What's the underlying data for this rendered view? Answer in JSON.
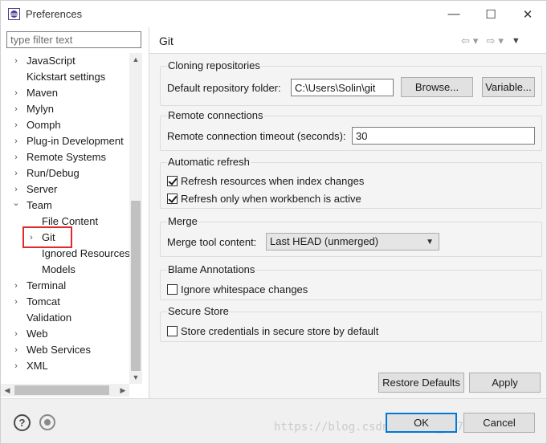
{
  "window": {
    "title": "Preferences",
    "minimize_glyph": "—",
    "maximize_glyph": "☐",
    "close_glyph": "✕"
  },
  "left": {
    "filter_placeholder": "type filter text",
    "tree": [
      {
        "label": "JavaScript",
        "level": 0,
        "expandable": true,
        "expanded": false
      },
      {
        "label": "Kickstart settings",
        "level": 0,
        "expandable": false
      },
      {
        "label": "Maven",
        "level": 0,
        "expandable": true,
        "expanded": false
      },
      {
        "label": "Mylyn",
        "level": 0,
        "expandable": true,
        "expanded": false
      },
      {
        "label": "Oomph",
        "level": 0,
        "expandable": true,
        "expanded": false
      },
      {
        "label": "Plug-in Development",
        "level": 0,
        "expandable": true,
        "expanded": false
      },
      {
        "label": "Remote Systems",
        "level": 0,
        "expandable": true,
        "expanded": false
      },
      {
        "label": "Run/Debug",
        "level": 0,
        "expandable": true,
        "expanded": false
      },
      {
        "label": "Server",
        "level": 0,
        "expandable": true,
        "expanded": false
      },
      {
        "label": "Team",
        "level": 0,
        "expandable": true,
        "expanded": true
      },
      {
        "label": "File Content",
        "level": 1,
        "expandable": false
      },
      {
        "label": "Git",
        "level": 1,
        "expandable": true,
        "expanded": false,
        "selected": true
      },
      {
        "label": "Ignored Resources",
        "level": 1,
        "expandable": false
      },
      {
        "label": "Models",
        "level": 1,
        "expandable": false
      },
      {
        "label": "Terminal",
        "level": 0,
        "expandable": true,
        "expanded": false
      },
      {
        "label": "Tomcat",
        "level": 0,
        "expandable": true,
        "expanded": false
      },
      {
        "label": "Validation",
        "level": 0,
        "expandable": false
      },
      {
        "label": "Web",
        "level": 0,
        "expandable": true,
        "expanded": false
      },
      {
        "label": "Web Services",
        "level": 0,
        "expandable": true,
        "expanded": false
      },
      {
        "label": "XML",
        "level": 0,
        "expandable": true,
        "expanded": false
      }
    ]
  },
  "page": {
    "title": "Git",
    "nav": {
      "back": "⇦",
      "forward": "⇨",
      "dropdown": "▾",
      "menu": "▼"
    },
    "cloning": {
      "title": "Cloning repositories",
      "folder_label": "Default repository folder:",
      "folder_value": "C:\\Users\\Solin\\git",
      "browse_label": "Browse...",
      "variable_label": "Variable..."
    },
    "remote": {
      "title": "Remote connections",
      "timeout_label": "Remote connection timeout (seconds):",
      "timeout_value": "30"
    },
    "refresh": {
      "title": "Automatic refresh",
      "index_label": "Refresh resources when index changes",
      "index_checked": true,
      "workbench_label": "Refresh only when workbench is active",
      "workbench_checked": true
    },
    "merge": {
      "title": "Merge",
      "tool_label": "Merge tool content:",
      "tool_value": "Last HEAD (unmerged)"
    },
    "blame": {
      "title": "Blame Annotations",
      "whitespace_label": "Ignore whitespace changes",
      "whitespace_checked": false
    },
    "secure": {
      "title": "Secure Store",
      "store_label": "Store credentials in secure store by default",
      "store_checked": false
    },
    "restore_label": "Restore Defaults",
    "apply_label": "Apply"
  },
  "footer": {
    "ok_label": "OK",
    "cancel_label": "Cancel",
    "watermark": "https://blog.csdn.net/qq_32786873"
  },
  "colors": {
    "highlight_border": "#e02a2a",
    "primary_border": "#0078d7"
  }
}
